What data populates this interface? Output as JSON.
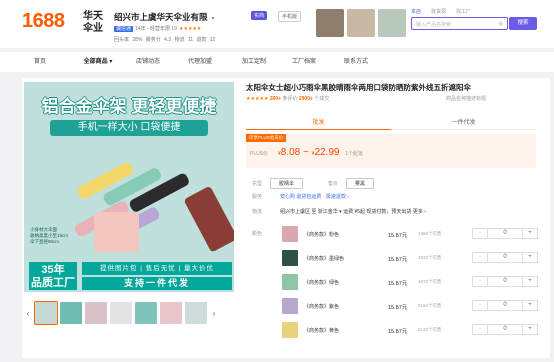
{
  "header": {
    "logo": "1688",
    "shop_logo": "华天\n伞业",
    "shop_name": "绍兴市上虞华天伞业有限",
    "shop_dropdown": "▾",
    "tag_flag": "实商",
    "tag_mobile": "手机版",
    "meta_badge": "诚信通",
    "meta_line1": "14年 · 经营年限 19",
    "meta_stars": "★★★★★",
    "meta_line2": "回头率 28%   服务分 4.3   物流 11   退款 12",
    "search_tabs": [
      "本店",
      "找货源",
      "找工厂"
    ],
    "search_placeholder": "输入产品名搜索",
    "search_button": "搜索"
  },
  "nav": [
    "首页",
    "全部商品 ▾",
    "店铺动态",
    "代理加盟",
    "加工定制",
    "工厂档案",
    "联系方式"
  ],
  "product": {
    "img_headline": "铝合金伞架 更轻更便捷",
    "img_sub": "手机一样大小 口袋便捷",
    "img_note": "小身材大伞面\n收纳高度小至18cm\n伞下直径90cm",
    "img_badge": "35年\n品质工厂",
    "img_bar1": "提供图片包 | 售后无忧 | 量大价优",
    "img_bar2": "支持一件代发",
    "title": "太阳伞女士超小巧雨伞黑胶晴雨伞两用口袋防晒防紫外线五折遮阳伞",
    "stars": "★★★★★",
    "rating_count": "300+",
    "rating_label": "条评价",
    "sold_count": "2900+",
    "sold_label": "个成交",
    "rating_right": "商品名称描述标题",
    "tab_active": "批发",
    "tab_other": "一件代发",
    "plus_badge": "尽享PLUS会员价",
    "price_label": "PLUS价",
    "price_low": "8.08",
    "price_high": "22.99",
    "price_unit": "¥",
    "price_note": "1个起批"
  },
  "rows": {
    "pattern_label": "花型",
    "pattern_value": "胶晴伞",
    "price_label2": "售价",
    "price_value": "雾黑",
    "safety_label": "服务",
    "safety_blue": "安心购",
    "safety_value": "退货包运费 · 极速退款 ›",
    "ship_label": "物流",
    "ship_value": "绍兴市上虞区 至 浙江金华 ▾   运费 ¥5起   现货付款，预天出货 更多 ›"
  },
  "skus": [
    {
      "label": "颜色",
      "name": "《商务款》粉色",
      "price": "15.87元",
      "stock": "1986个可售",
      "qty": "0",
      "color": "#d9a7ad"
    },
    {
      "label": "",
      "name": "《商务款》墨绿色",
      "price": "15.87元",
      "stock": "4932个可售",
      "qty": "0",
      "color": "#2f5147"
    },
    {
      "label": "",
      "name": "《商务款》绿色",
      "price": "15.87元",
      "stock": "4870个可售",
      "qty": "0",
      "color": "#8ec5a3"
    },
    {
      "label": "",
      "name": "《商务款》紫色",
      "price": "15.87元",
      "stock": "5154个可售",
      "qty": "0",
      "color": "#b6a7cf"
    },
    {
      "label": "",
      "name": "《商务款》黄色",
      "price": "15.87元",
      "stock": "8132个可售",
      "qty": "0",
      "color": "#e9d27b"
    }
  ],
  "stepper": {
    "minus": "−",
    "plus": "+"
  },
  "gallery": {
    "prev": "‹",
    "next": "›",
    "count": 7
  }
}
